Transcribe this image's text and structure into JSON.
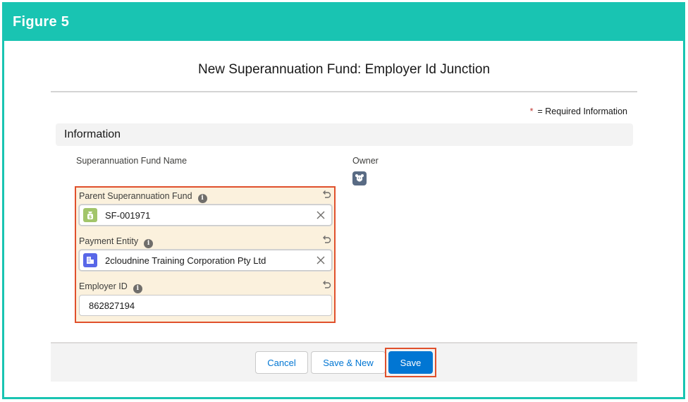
{
  "figure": {
    "title": "Figure 5"
  },
  "modal": {
    "title": "New Superannuation Fund: Employer Id Junction",
    "required_star": "*",
    "required_text": "= Required Information"
  },
  "section": {
    "label": "Information"
  },
  "fields": {
    "fund_name_label": "Superannuation Fund Name",
    "owner_label": "Owner",
    "parent_fund": {
      "label": "Parent Superannuation Fund",
      "value": "SF-001971",
      "icon": "money-bag-icon"
    },
    "payment_entity": {
      "label": "Payment Entity",
      "value": "2cloudnine Training Corporation Pty Ltd",
      "icon": "building-icon"
    },
    "employer_id": {
      "label": "Employer ID",
      "value": "862827194"
    }
  },
  "buttons": {
    "cancel": "Cancel",
    "save_new": "Save & New",
    "save": "Save"
  },
  "colors": {
    "accent_teal": "#19c4b2",
    "highlight_orange": "#e0502c",
    "brand_blue": "#0176d3",
    "field_bg": "#fbf1dd"
  }
}
